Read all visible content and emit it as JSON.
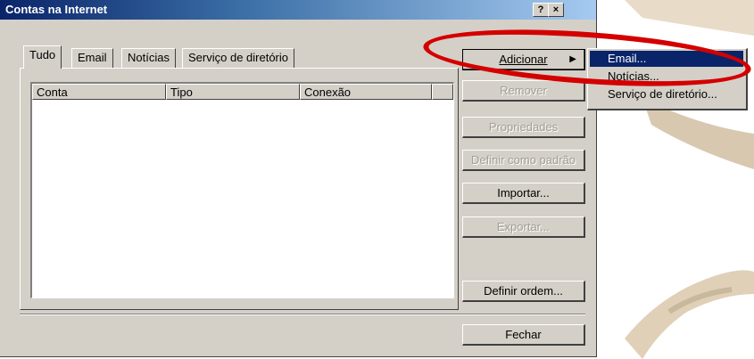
{
  "window": {
    "title": "Contas na Internet",
    "help_btn": "?",
    "close_btn": "×"
  },
  "tabs": [
    "Tudo",
    "Email",
    "Notícias",
    "Serviço de diretório"
  ],
  "columns": [
    "Conta",
    "Tipo",
    "Conexão"
  ],
  "buttons": {
    "add": "Adicionar",
    "remove": "Remover",
    "properties": "Propriedades",
    "set_default": "Definir como padrão",
    "import": "Importar...",
    "export": "Exportar...",
    "set_order": "Definir ordem...",
    "close": "Fechar"
  },
  "add_menu": [
    "Email...",
    "Notícias...",
    "Serviço de diretório..."
  ],
  "colors": {
    "title_start": "#0a246a",
    "menu_highlight": "#0a246a",
    "annotation": "#d40000"
  }
}
